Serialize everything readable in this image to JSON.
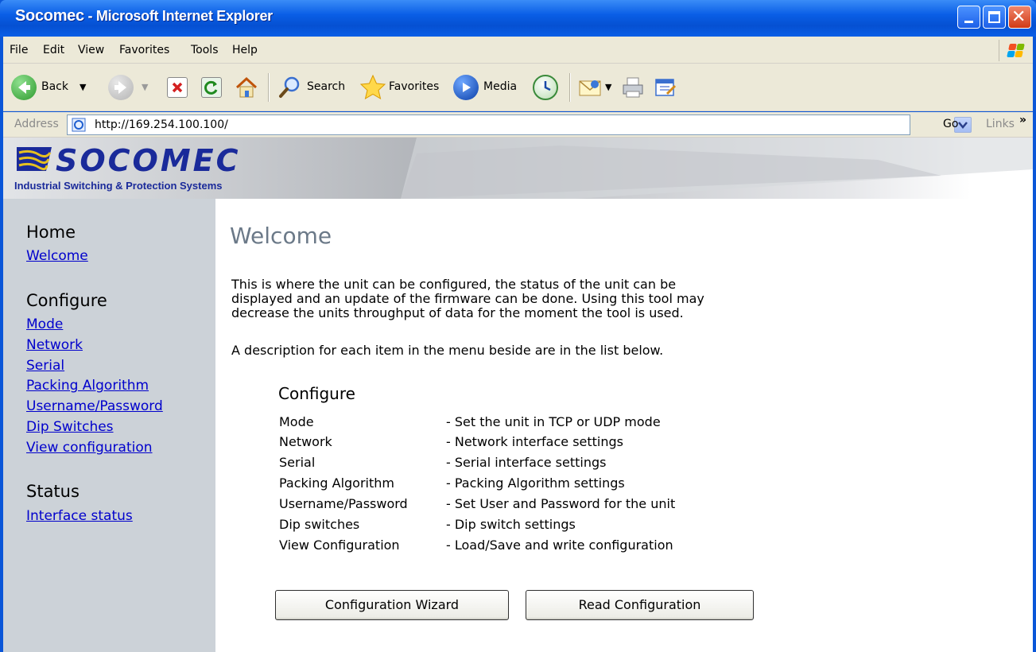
{
  "window": {
    "title_brand": "Socomec",
    "title_rest": " - Microsoft Internet Explorer"
  },
  "menu": {
    "items": [
      "File",
      "Edit",
      "View",
      "Favorites",
      "Tools",
      "Help"
    ]
  },
  "toolbar": {
    "back_label": "Back",
    "search_label": "Search",
    "favorites_label": "Favorites",
    "media_label": "Media"
  },
  "address": {
    "label": "Address",
    "url": "http://169.254.100.100/",
    "go_label": "Go",
    "links_label": "Links",
    "links_chevron": "»"
  },
  "banner": {
    "logo_text": "SOCOMEC",
    "tagline": "Industrial Switching & Protection Systems"
  },
  "sidebar": {
    "sections": [
      {
        "heading": "Home",
        "links": [
          "Welcome"
        ]
      },
      {
        "heading": "Configure",
        "links": [
          "Mode",
          "Network",
          "Serial",
          "Packing Algorithm",
          "Username/Password",
          "Dip Switches",
          "View configuration"
        ]
      },
      {
        "heading": "Status",
        "links": [
          "Interface status"
        ]
      }
    ]
  },
  "main": {
    "title": "Welcome",
    "intro_lines": [
      "This is where the unit can be configured, the status of the unit can be",
      "displayed and an update of the firmware can be done. Using this tool may",
      "decrease the units throughput of data for the moment the tool is used."
    ],
    "description": "A description for each item in the menu beside are in the list below.",
    "configure_heading": "Configure",
    "configure_items": [
      {
        "name": "Mode",
        "text": "- Set the unit in TCP or UDP mode"
      },
      {
        "name": "Network",
        "text": "- Network interface settings"
      },
      {
        "name": "Serial",
        "text": "- Serial interface settings"
      },
      {
        "name": "Packing Algorithm",
        "text": "- Packing Algorithm settings"
      },
      {
        "name": "Username/Password",
        "text": "- Set User and Password for the unit"
      },
      {
        "name": "Dip switches",
        "text": "- Dip switch settings"
      },
      {
        "name": "View Configuration",
        "text": "- Load/Save and write configuration"
      }
    ],
    "buttons": {
      "wizard": "Configuration Wizard",
      "read": "Read Configuration"
    }
  }
}
